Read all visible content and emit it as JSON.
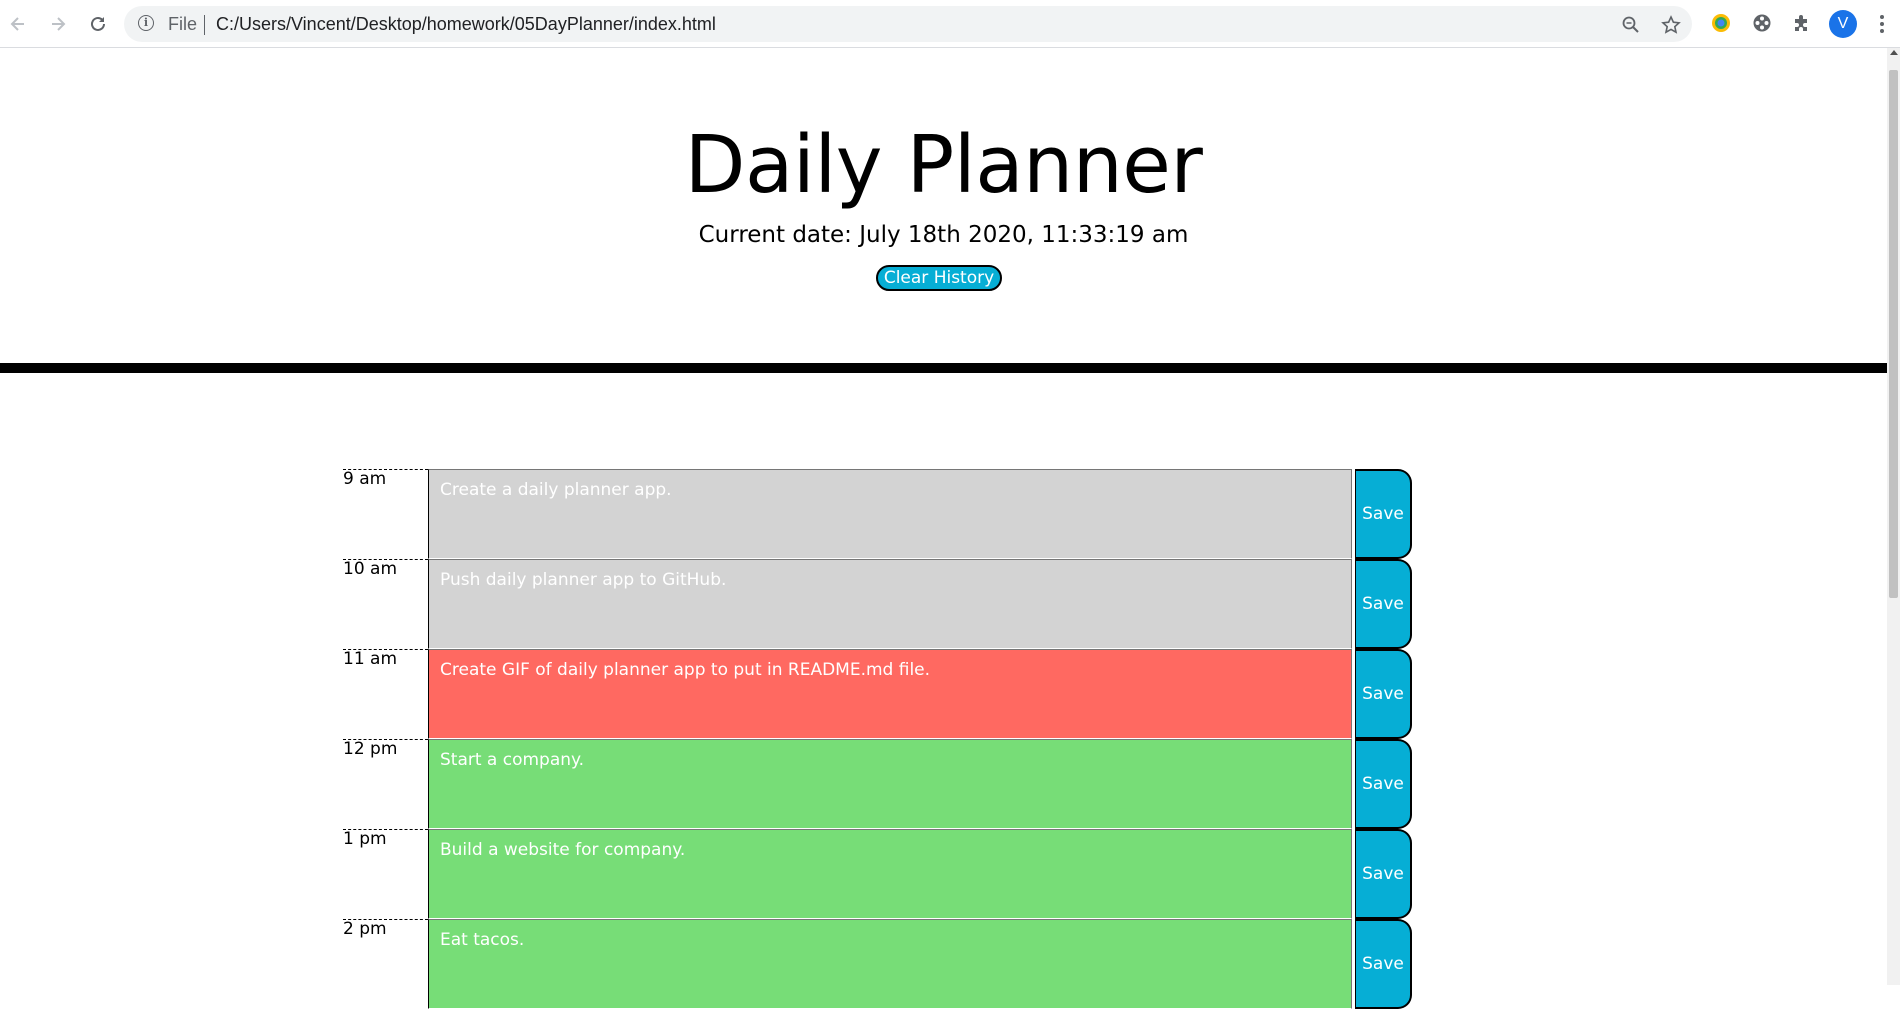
{
  "browser": {
    "scheme_label": "File",
    "url": "C:/Users/Vincent/Desktop/homework/05DayPlanner/index.html",
    "avatar_letter": "V"
  },
  "header": {
    "title": "Daily Planner",
    "current_date": "Current date: July 18th 2020, 11:33:19 am",
    "clear_label": "Clear History"
  },
  "colors": {
    "past": "#d3d3d3",
    "present": "#ff6961",
    "future": "#77dd77",
    "button": "#06aed5"
  },
  "timeblocks": [
    {
      "hour": "9 am",
      "text": "Create a daily planner app.",
      "state": "past",
      "save_label": "Save"
    },
    {
      "hour": "10 am",
      "text": "Push daily planner app to GitHub.",
      "state": "past",
      "save_label": "Save"
    },
    {
      "hour": "11 am",
      "text": "Create GIF of daily planner app to put in README.md file.",
      "state": "present",
      "save_label": "Save"
    },
    {
      "hour": "12 pm",
      "text": "Start a company.",
      "state": "future",
      "save_label": "Save"
    },
    {
      "hour": "1 pm",
      "text": "Build a website for company.",
      "state": "future",
      "save_label": "Save"
    },
    {
      "hour": "2 pm",
      "text": "Eat tacos.",
      "state": "future",
      "save_label": "Save"
    }
  ]
}
